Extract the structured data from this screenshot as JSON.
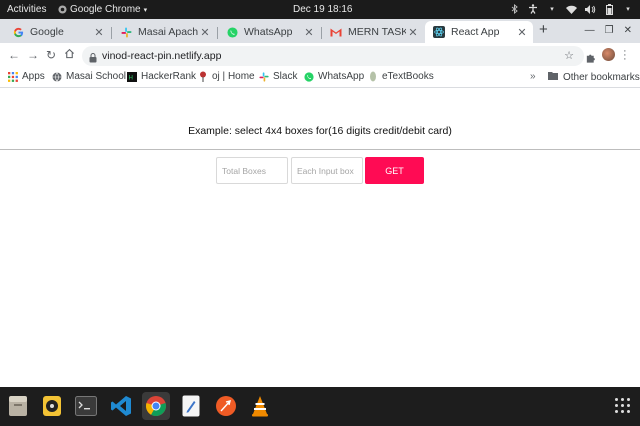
{
  "topbar": {
    "activities": "Activities",
    "app_menu": "Google Chrome",
    "clock": "Dec 19  18:16"
  },
  "tabs": [
    {
      "title": "Google",
      "icon": "google-icon"
    },
    {
      "title": "Masai Apache | SI",
      "icon": "slack-icon"
    },
    {
      "title": "WhatsApp",
      "icon": "whatsapp-icon"
    },
    {
      "title": "MERN TASK MAS",
      "icon": "gmail-icon"
    },
    {
      "title": "React App",
      "icon": "react-icon",
      "active": true
    }
  ],
  "address": {
    "url": "vinod-react-pin.netlify.app"
  },
  "bookmarks": [
    {
      "label": "Apps",
      "icon": "apps-grid-icon"
    },
    {
      "label": "Masai School",
      "icon": "globe-icon"
    },
    {
      "label": "HackerRank",
      "icon": "hackerrank-icon"
    },
    {
      "label": "oj | Home",
      "icon": "pin-icon"
    },
    {
      "label": "Slack",
      "icon": "slack-icon"
    },
    {
      "label": "WhatsApp",
      "icon": "whatsapp-icon"
    },
    {
      "label": "eTextBooks",
      "icon": "book-icon"
    }
  ],
  "bookmarks_more": "»",
  "other_bookmarks": "Other bookmarks",
  "page": {
    "example_text": "Example: select 4x4 boxes for(16 digits credit/debit card)",
    "total_boxes_placeholder": "Total Boxes",
    "each_input_placeholder": "Each Input box",
    "get_button": "GET"
  },
  "colors": {
    "accent": "#ff0b54",
    "topbar": "#1b1b1b",
    "tabstrip": "#dee1e6"
  },
  "dock": [
    {
      "name": "files"
    },
    {
      "name": "rhythmbox"
    },
    {
      "name": "terminal"
    },
    {
      "name": "vscode"
    },
    {
      "name": "chrome",
      "active": true
    },
    {
      "name": "text-editor"
    },
    {
      "name": "postman"
    },
    {
      "name": "vlc"
    }
  ]
}
